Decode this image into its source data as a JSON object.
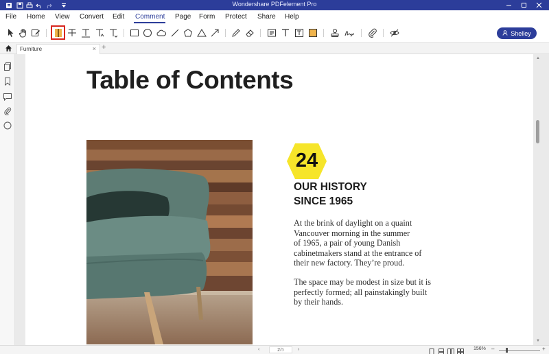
{
  "window": {
    "title": "Wondershare PDFelement Pro"
  },
  "menu": {
    "items": [
      "File",
      "Home",
      "View",
      "Convert",
      "Edit",
      "Comment",
      "Page",
      "Form",
      "Protect",
      "Share",
      "Help"
    ],
    "active": "Comment"
  },
  "toolbar": {
    "icons": [
      "select-icon",
      "hand-icon",
      "edit-annotation-icon",
      "highlight-icon",
      "strikethrough-text-icon",
      "underline-text-icon",
      "insert-text-icon",
      "replace-text-icon",
      "rectangle-icon",
      "oval-icon",
      "cloud-icon",
      "line-icon",
      "polygon-icon",
      "arrow-icon",
      "pencil-icon",
      "eraser-icon",
      "text-box-icon",
      "typewriter-icon",
      "text-callout-icon",
      "note-icon",
      "stamp-icon",
      "signature-icon",
      "attachment-icon",
      "hide-annotations-icon"
    ],
    "selected_tool": "highlight-icon",
    "user_label": "Shelley"
  },
  "tabs": {
    "document": "Furniture",
    "close_glyph": "×",
    "new_glyph": "+"
  },
  "document": {
    "heading": "Table of Contents",
    "badge_number": "24",
    "badge_color": "#f6e52a",
    "history_title_line1": "OUR HISTORY",
    "history_title_line2": "SINCE 1965",
    "paragraph1": [
      "At the brink of daylight on a quaint",
      "Vancouver morning in the summer",
      "of 1965, a pair of young Danish",
      "cabinetmakers stand at the entrance of",
      "their new factory. They’re proud."
    ],
    "paragraph2": [
      "The space may be modest in size but it is",
      "perfectly formed; all painstakingly built",
      "by their hands."
    ]
  },
  "statusbar": {
    "page_current": "2",
    "page_total": "/5",
    "zoom": "156%",
    "zoom_level_percent": 18
  },
  "colors": {
    "brand": "#2c3d9a",
    "selection": "#d8261f"
  }
}
